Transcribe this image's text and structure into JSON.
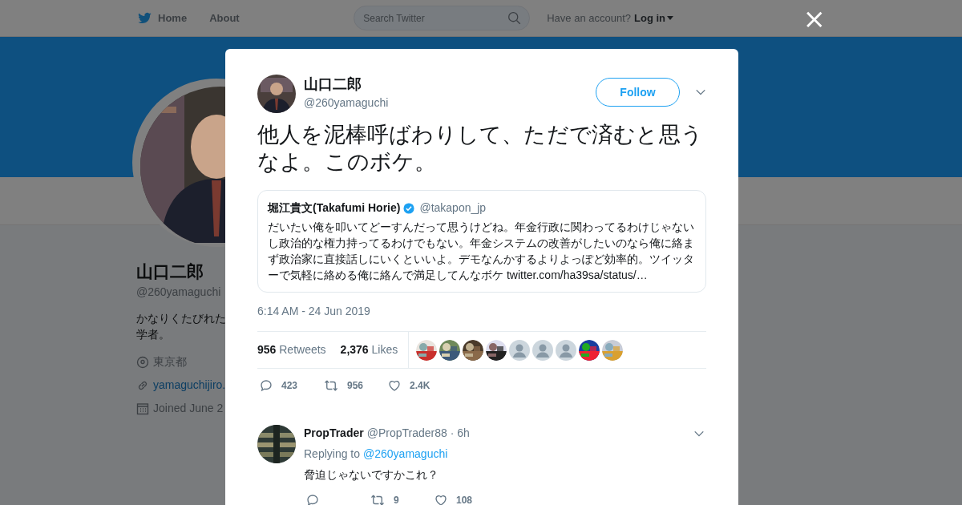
{
  "nav": {
    "home": "Home",
    "about": "About",
    "search": {
      "placeholder": "Search Twitter"
    },
    "account_prompt": "Have an account?",
    "login": "Log in"
  },
  "profile": {
    "name": "山口二郎",
    "handle": "@260yamaguchi",
    "bio": [
      "かなりくたびれた",
      "学者。"
    ],
    "location": "東京都",
    "website": "yamaguchijiro.",
    "joined": "Joined June 2"
  },
  "tweet": {
    "name": "山口二郎",
    "handle": "@260yamaguchi",
    "follow": "Follow",
    "text": "他人を泥棒呼ばわりして、ただで済むと思うなよ。このボケ。",
    "quote": {
      "name": "堀江貴文(Takafumi Horie)",
      "verified": true,
      "handle": "@takapon_jp",
      "text": "だいたい俺を叩いてどーすんだって思うけどね。年金行政に関わってるわけじゃないし政治的な権力持ってるわけでもない。年金システムの改善がしたいのなら俺に絡まず政治家に直接話しにいくといいよ。デモなんかするよりよっぽど効率的。ツイッターで気軽に絡める俺に絡んで満足してんなボケ twitter.com/ha39sa/status/…"
    },
    "timestamp": "6:14 AM - 24 Jun 2019",
    "retweets": {
      "count": "956",
      "label": "Retweets"
    },
    "likes": {
      "count": "2,376",
      "label": "Likes"
    },
    "likers": [
      {
        "kind": "picture"
      },
      {
        "kind": "picture"
      },
      {
        "kind": "picture"
      },
      {
        "kind": "picture"
      },
      {
        "kind": "default"
      },
      {
        "kind": "default"
      },
      {
        "kind": "default"
      },
      {
        "kind": "picture"
      },
      {
        "kind": "picture"
      }
    ],
    "actions": {
      "replies": "423",
      "retweets": "956",
      "likes": "2.4K"
    }
  },
  "reply": {
    "name": "PropTrader",
    "handle": "@PropTrader88",
    "time": "· 6h",
    "replying_to": "Replying to",
    "mention": "@260yamaguchi",
    "text": "脅迫じゃないですかこれ？",
    "actions": {
      "retweets": "9",
      "likes": "108"
    }
  },
  "close": "×"
}
